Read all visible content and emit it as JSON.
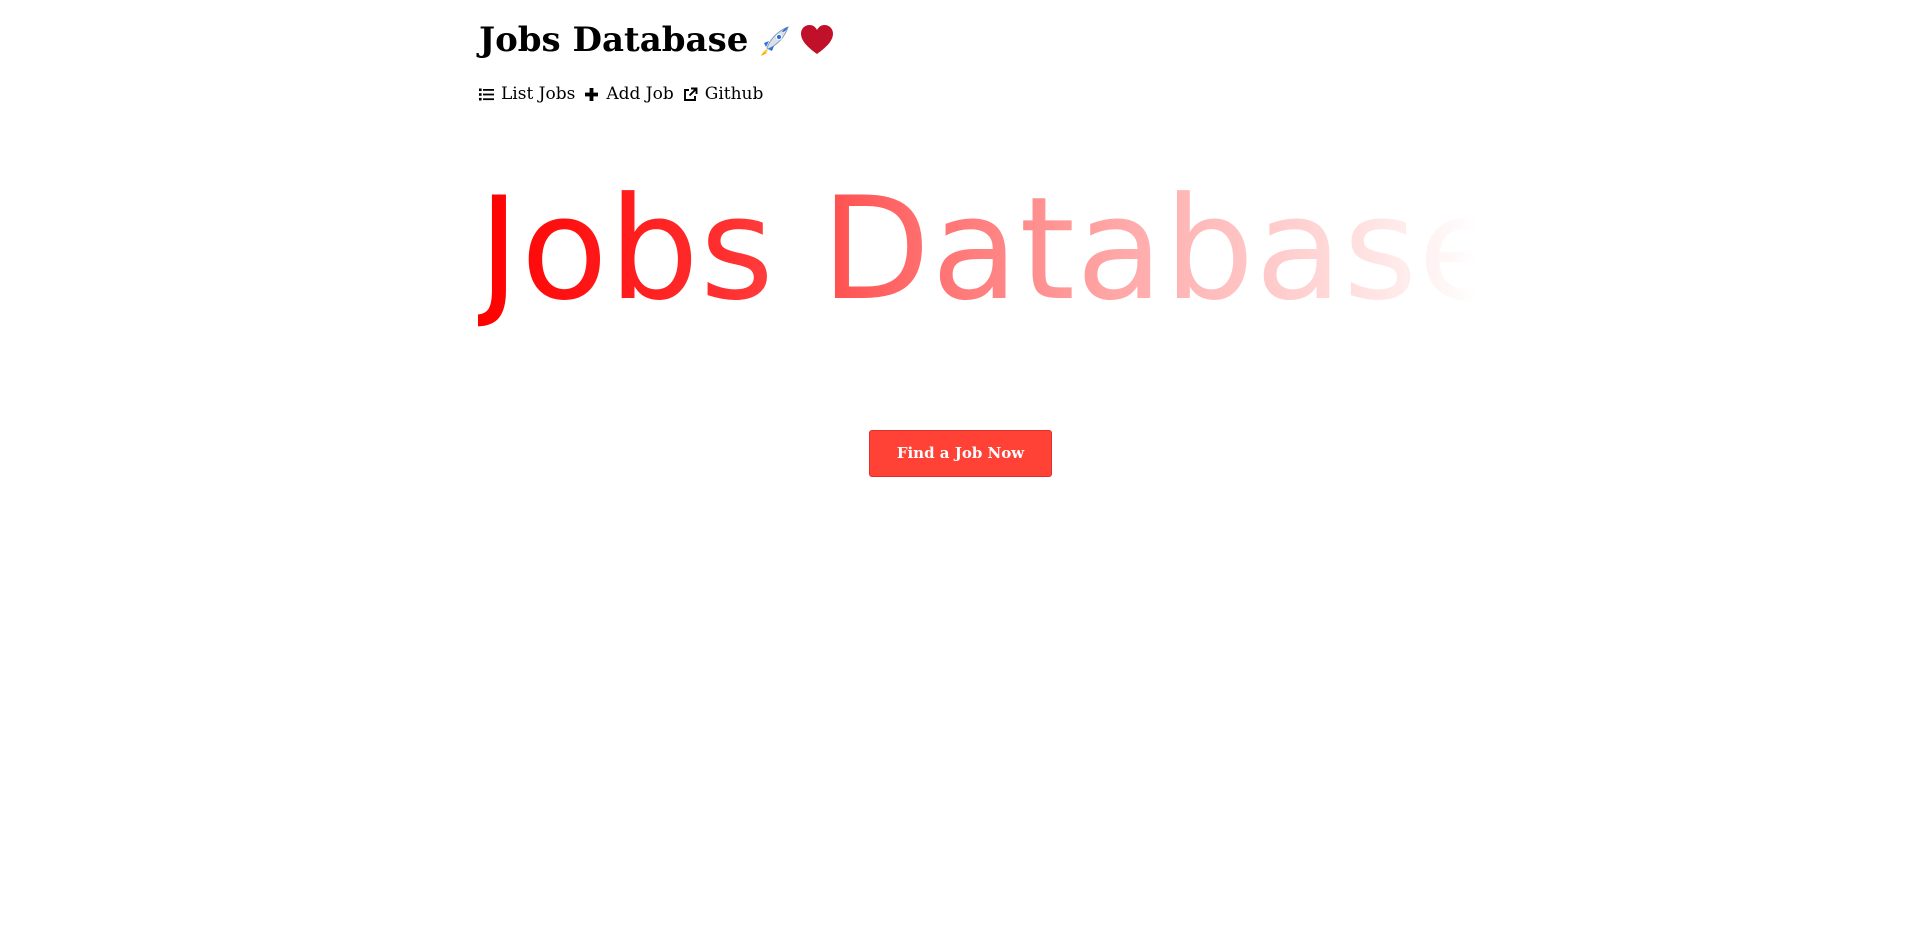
{
  "header": {
    "title": "Jobs Database",
    "icons": [
      "rocket-icon",
      "heart-icon"
    ]
  },
  "nav": {
    "items": [
      {
        "label": "List Jobs",
        "icon": "list-icon"
      },
      {
        "label": "Add Job",
        "icon": "plus-icon"
      },
      {
        "label": "Github",
        "icon": "external-link-icon"
      }
    ]
  },
  "hero": {
    "title": "Jobs Database"
  },
  "cta": {
    "label": "Find a Job Now"
  },
  "colors": {
    "accent": "#ff4136",
    "hero_gradient_start": "#ff0000",
    "hero_gradient_end": "#ffffff",
    "heart": "#c0102a"
  }
}
